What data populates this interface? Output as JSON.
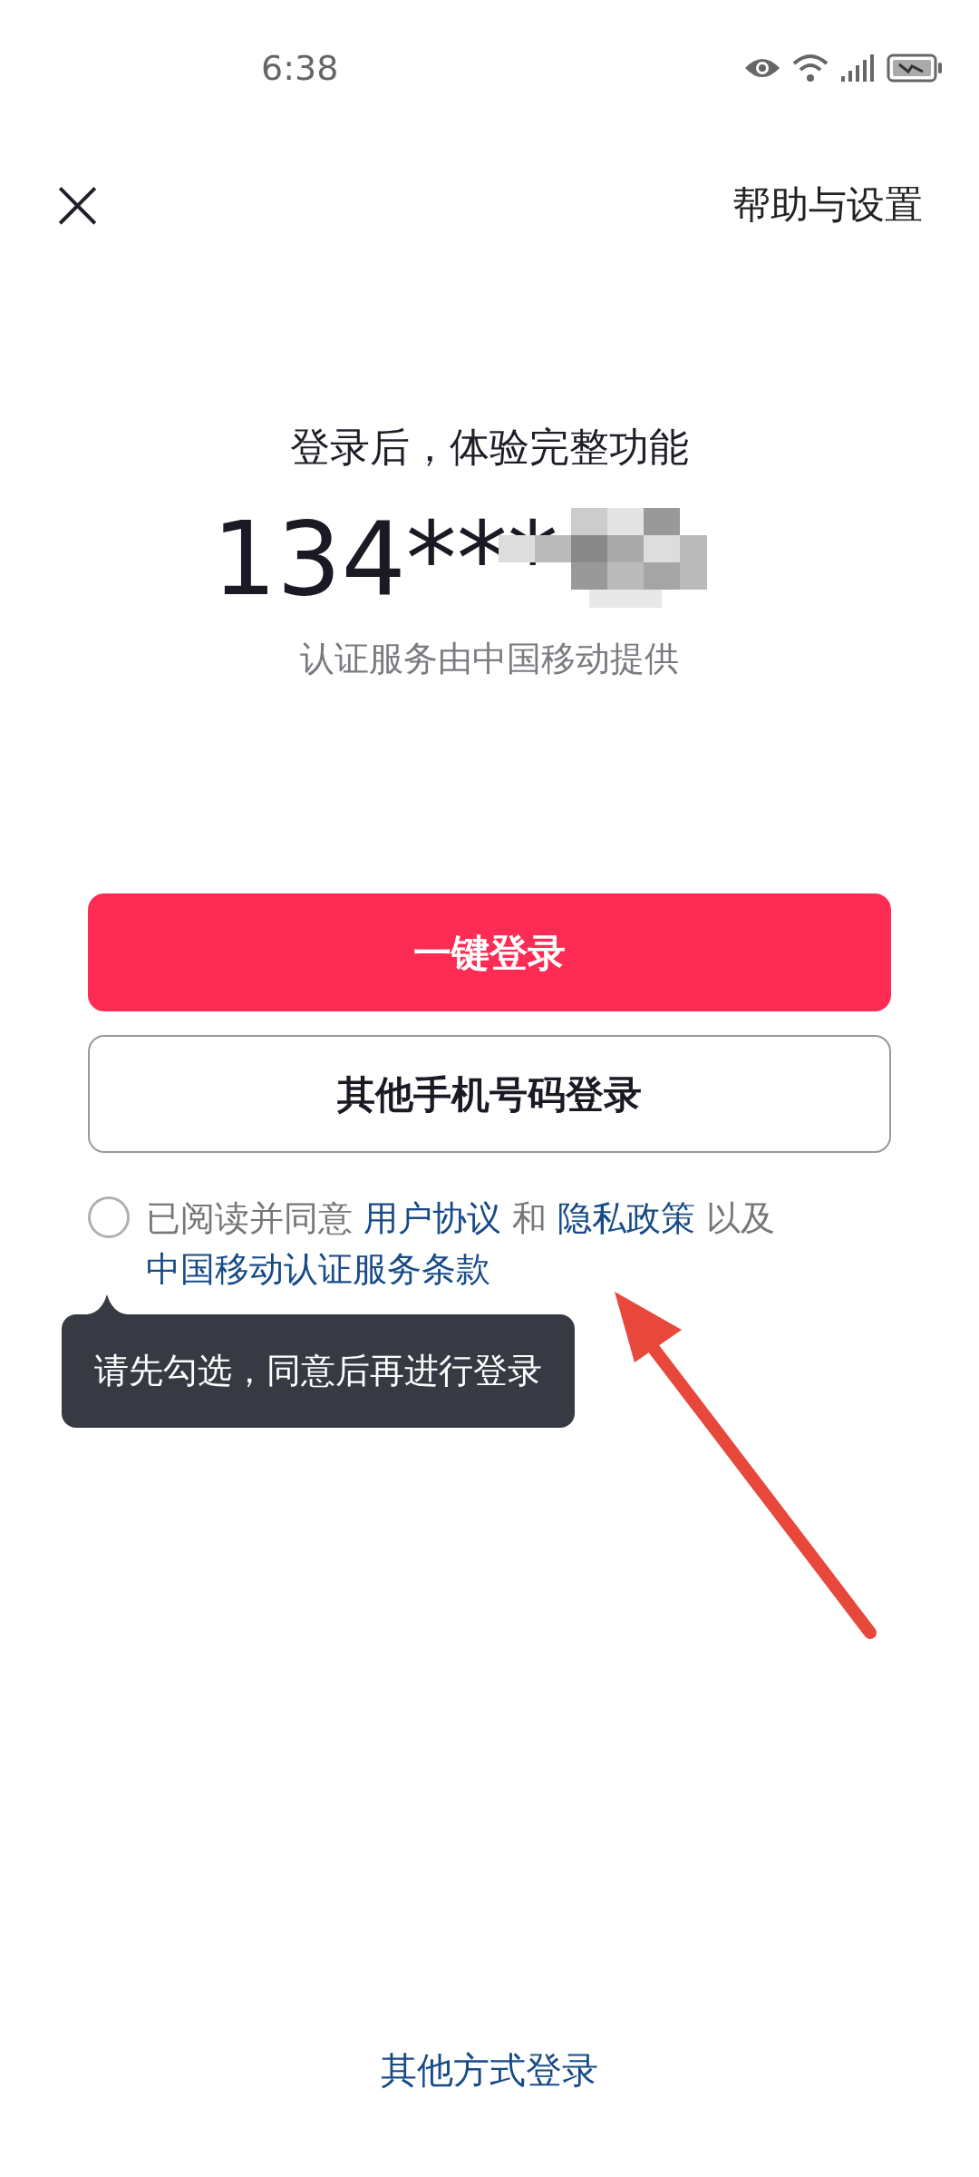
{
  "status_bar": {
    "time": "6:38"
  },
  "top_bar": {
    "close_button": "×",
    "help_link": "帮助与设置"
  },
  "headline": "登录后，体验完整功能",
  "phone_number": "134***",
  "provider_note": "认证服务由中国移动提供",
  "buttons": [
    {
      "label": "一键登录",
      "kind": "primary"
    },
    {
      "label": "其他手机号码登录",
      "kind": "outline"
    }
  ],
  "agreement": {
    "checked": false,
    "segments": [
      {
        "text": "已阅读并同意",
        "kind": "plain"
      },
      {
        "text": "用户协议",
        "kind": "link"
      },
      {
        "text": "和",
        "kind": "plain"
      },
      {
        "text": "隐私政策",
        "kind": "link"
      },
      {
        "text": "以及",
        "kind": "plain"
      },
      {
        "text": "中国移动认证服务条款",
        "kind": "link"
      }
    ]
  },
  "tooltip": "请先勾选，同意后再进行登录",
  "other_login_link": "其他方式登录"
}
